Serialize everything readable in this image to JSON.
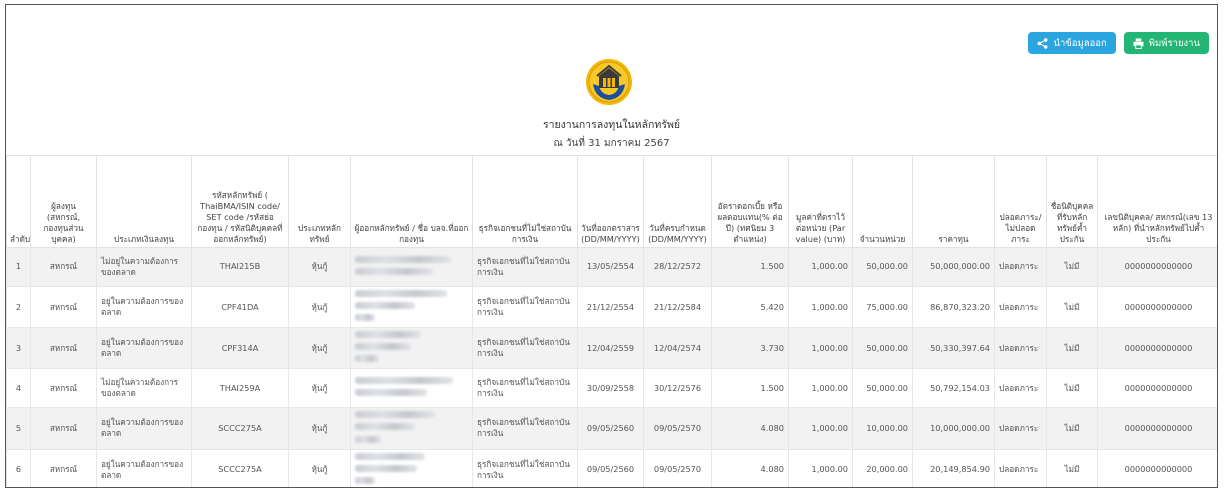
{
  "toolbar": {
    "share_label": "นำข้อมูลออก",
    "print_label": "พิมพ์รายงาน"
  },
  "report": {
    "title": "รายงานการลงทุนในหลักทรัพย์",
    "as_of": "ณ วันที่ 31 มกราคม 2567"
  },
  "colors": {
    "share_button": "#2aa5e0",
    "print_button": "#22b573",
    "row_stripe": "#f2f2f2",
    "logo_gold": "#f2b705",
    "logo_blue": "#1f4e9a"
  },
  "icons": {
    "share": "share-icon",
    "print": "printer-icon",
    "logo": "emblem-logo"
  },
  "table": {
    "headers": [
      "ลำดับ",
      "ผู้ลงทุน (สหกรณ์, กองทุนส่วนบุคคล)",
      "ประเภทเงินลงทุน",
      "รหัสหลักทรัพย์ ( ThaiBMA/ISIN code/ SET code /รหัสย่อกองทุน / รหัสนิติบุคคลที่ออกหลักทรัพย์)",
      "ประเภทหลักทรัพย์",
      "ผู้ออกหลักทรัพย์ / ชื่อ บลจ.ที่ออกกองทุน",
      "ธุรกิจเอกชนที่ไม่ใช่สถาบันการเงิน",
      "วันที่ออกตราสาร (DD/MM/YYYY)",
      "วันที่ครบกำหนด (DD/MM/YYYY)",
      "อัตราดอกเบี้ย หรือ ผลตอบแทน(% ต่อปี) (ทศนิยม 3 ตำแหน่ง)",
      "มูลค่าที่ตราไว้ต่อหน่วย (Par value) (บาท)",
      "จำนวนหน่วย",
      "ราคาทุน",
      "ปลอดภาระ/ ไม่ปลอดภาระ",
      "ชื่อนิติบุคคลที่รับหลักทรัพย์ค้ำประกัน",
      "เลขนิติบุคคล/ สหกรณ์(เลข 13 หลัก) ที่นำหลักทรัพย์ไปค้ำประกัน"
    ],
    "rows": [
      {
        "no": "1",
        "investor": "สหกรณ์",
        "inv_type": "ไม่อยู่ในความต้องการของตลาด",
        "code": "THAI215B",
        "sec_type": "หุ้นกู้",
        "business": "ธุรกิจเอกชนที่ไม่ใช่สถาบันการเงิน",
        "issue_date": "13/05/2554",
        "maturity": "28/12/2572",
        "rate": "1.500",
        "par": "1,000.00",
        "units": "50,000.00",
        "cost": "50,000,000.00",
        "encumbrance": "ปลอดภาระ",
        "guarantor": "ไม่มี",
        "reg_no": "0000000000000"
      },
      {
        "no": "2",
        "investor": "สหกรณ์",
        "inv_type": "อยู่ในความต้องการของตลาด",
        "code": "CPF41DA",
        "sec_type": "หุ้นกู้",
        "business": "ธุรกิจเอกชนที่ไม่ใช่สถาบันการเงิน",
        "issue_date": "21/12/2554",
        "maturity": "21/12/2584",
        "rate": "5.420",
        "par": "1,000.00",
        "units": "75,000.00",
        "cost": "86,870,323.20",
        "encumbrance": "ปลอดภาระ",
        "guarantor": "ไม่มี",
        "reg_no": "0000000000000"
      },
      {
        "no": "3",
        "investor": "สหกรณ์",
        "inv_type": "อยู่ในความต้องการของตลาด",
        "code": "CPF314A",
        "sec_type": "หุ้นกู้",
        "business": "ธุรกิจเอกชนที่ไม่ใช่สถาบันการเงิน",
        "issue_date": "12/04/2559",
        "maturity": "12/04/2574",
        "rate": "3.730",
        "par": "1,000.00",
        "units": "50,000.00",
        "cost": "50,330,397.64",
        "encumbrance": "ปลอดภาระ",
        "guarantor": "ไม่มี",
        "reg_no": "0000000000000"
      },
      {
        "no": "4",
        "investor": "สหกรณ์",
        "inv_type": "ไม่อยู่ในความต้องการของตลาด",
        "code": "THAI259A",
        "sec_type": "หุ้นกู้",
        "business": "ธุรกิจเอกชนที่ไม่ใช่สถาบันการเงิน",
        "issue_date": "30/09/2558",
        "maturity": "30/12/2576",
        "rate": "1.500",
        "par": "1,000.00",
        "units": "50,000.00",
        "cost": "50,792,154.03",
        "encumbrance": "ปลอดภาระ",
        "guarantor": "ไม่มี",
        "reg_no": "0000000000000"
      },
      {
        "no": "5",
        "investor": "สหกรณ์",
        "inv_type": "อยู่ในความต้องการของตลาด",
        "code": "SCCC275A",
        "sec_type": "หุ้นกู้",
        "business": "ธุรกิจเอกชนที่ไม่ใช่สถาบันการเงิน",
        "issue_date": "09/05/2560",
        "maturity": "09/05/2570",
        "rate": "4.080",
        "par": "1,000.00",
        "units": "10,000.00",
        "cost": "10,000,000.00",
        "encumbrance": "ปลอดภาระ",
        "guarantor": "ไม่มี",
        "reg_no": "0000000000000"
      },
      {
        "no": "6",
        "investor": "สหกรณ์",
        "inv_type": "อยู่ในความต้องการของตลาด",
        "code": "SCCC275A",
        "sec_type": "หุ้นกู้",
        "business": "ธุรกิจเอกชนที่ไม่ใช่สถาบันการเงิน",
        "issue_date": "09/05/2560",
        "maturity": "09/05/2570",
        "rate": "4.080",
        "par": "1,000.00",
        "units": "20,000.00",
        "cost": "20,149,854.90",
        "encumbrance": "ปลอดภาระ",
        "guarantor": "ไม่มี",
        "reg_no": "0000000000000"
      }
    ]
  }
}
